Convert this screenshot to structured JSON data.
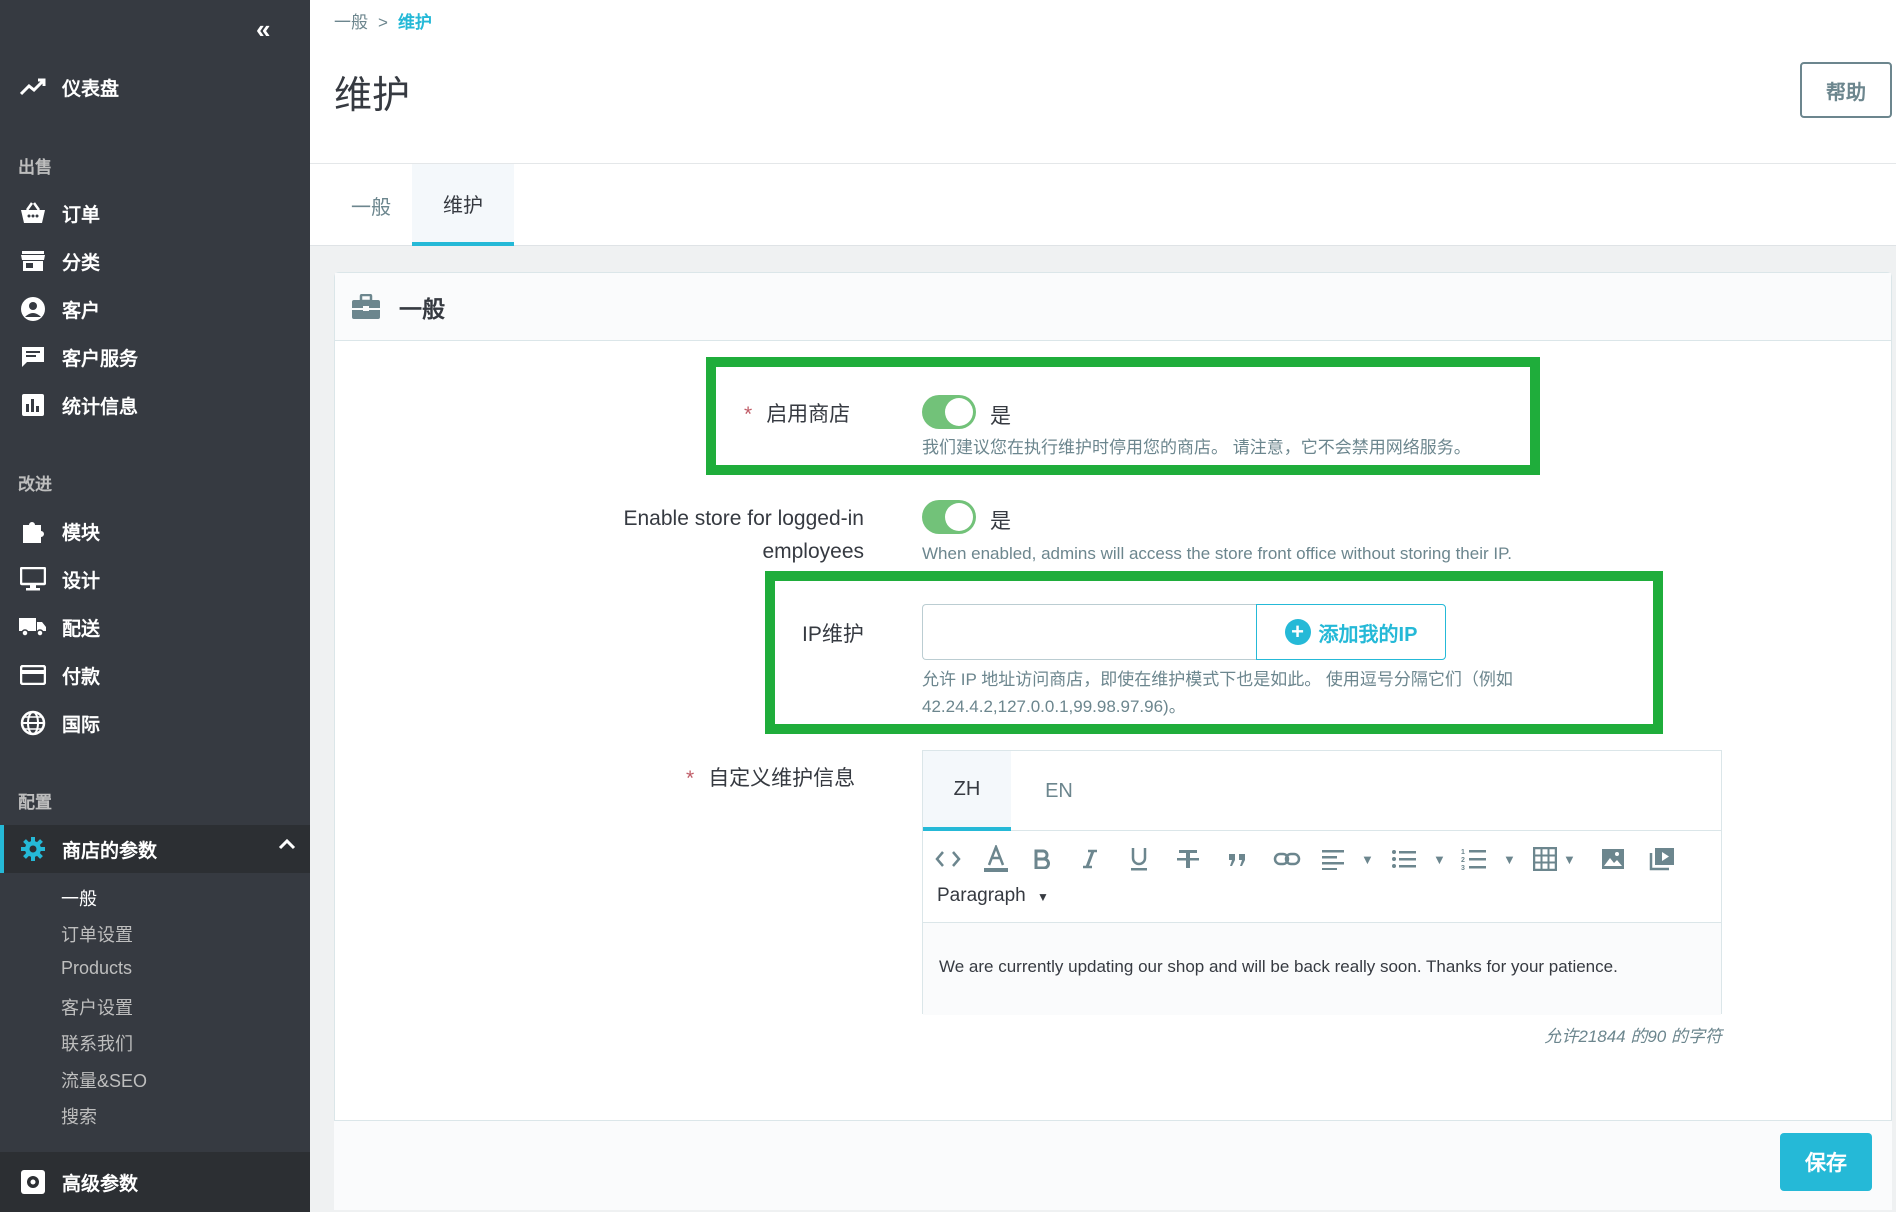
{
  "sidebar": {
    "collapse_icon": "«",
    "dashboard": "仪表盘",
    "sections": {
      "sell": "出售",
      "improve": "改进",
      "configure": "配置"
    },
    "sell_items": [
      {
        "label": "订单",
        "icon": "basket-icon"
      },
      {
        "label": "分类",
        "icon": "store-icon"
      },
      {
        "label": "客户",
        "icon": "user-circle-icon"
      },
      {
        "label": "客户服务",
        "icon": "chat-icon"
      },
      {
        "label": "统计信息",
        "icon": "bar-chart-icon"
      }
    ],
    "improve_items": [
      {
        "label": "模块",
        "icon": "puzzle-icon"
      },
      {
        "label": "设计",
        "icon": "monitor-icon"
      },
      {
        "label": "配送",
        "icon": "truck-icon"
      },
      {
        "label": "付款",
        "icon": "credit-card-icon"
      },
      {
        "label": "国际",
        "icon": "globe-icon"
      }
    ],
    "shop_params": "商店的参数",
    "sub_items": [
      "一般",
      "订单设置",
      "Products",
      "客户设置",
      "联系我们",
      "流量&SEO",
      "搜索"
    ],
    "advanced": "高级参数"
  },
  "header": {
    "breadcrumb": [
      "一般",
      "维护"
    ],
    "breadcrumb_sep": ">",
    "title": "维护",
    "help": "帮助",
    "tabs": [
      "一般",
      "维护"
    ]
  },
  "card": {
    "title": "一般",
    "enable_shop": {
      "label": "启用商店",
      "required_mark": "*",
      "value": "是",
      "enabled": true,
      "help": "我们建议您在执行维护时停用您的商店。 请注意，它不会禁用网络服务。"
    },
    "enable_logged": {
      "label_line1": "Enable store for logged-in",
      "label_line2": "employees",
      "value": "是",
      "enabled": true,
      "help": "When enabled, admins will access the store front office without storing their IP."
    },
    "ip": {
      "label": "IP维护",
      "value": "",
      "button": "添加我的IP",
      "help_line1": "允许 IP 地址访问商店，即使在维护模式下也是如此。 使用逗号分隔它们（例如",
      "help_line2": "42.24.4.2,127.0.0.1,99.98.97.96)。"
    },
    "custom_message": {
      "label": "自定义维护信息",
      "required_mark": "*",
      "languages": [
        "ZH",
        "EN"
      ],
      "paragraph": "Paragraph",
      "content": "We are currently updating our shop and will be back really soon. Thanks for your patience.",
      "counter": "允许21844 的90 的字符"
    },
    "save": "保存"
  },
  "colors": {
    "accent": "#25b9d7",
    "sidebar_bg": "#363a41",
    "toggle_on": "#72c279",
    "highlight": "#1fad3b"
  }
}
